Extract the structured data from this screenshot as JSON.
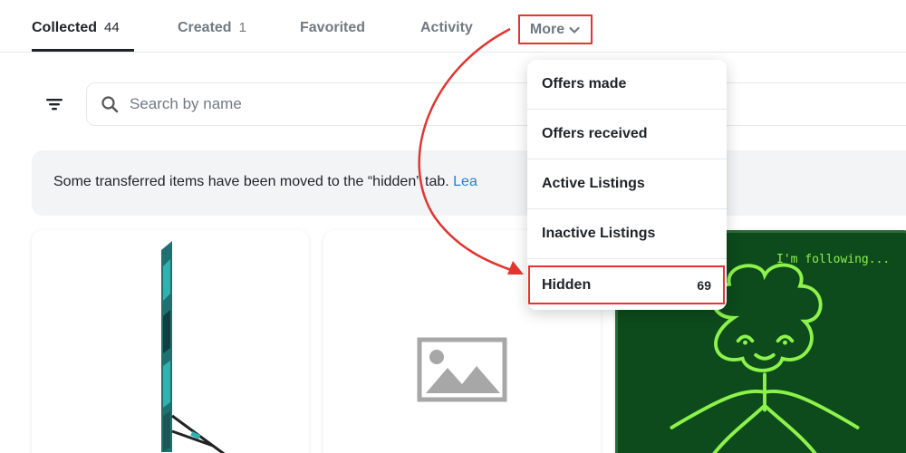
{
  "tabs": [
    {
      "label": "Collected",
      "count": "44"
    },
    {
      "label": "Created",
      "count": "1"
    },
    {
      "label": "Favorited"
    },
    {
      "label": "Activity"
    }
  ],
  "more": {
    "label": "More"
  },
  "search": {
    "placeholder": "Search by name"
  },
  "notice": {
    "text": "Some transferred items have been moved to the “hidden” tab. ",
    "link": "Lea"
  },
  "dropdown": {
    "items": [
      {
        "label": "Offers made"
      },
      {
        "label": "Offers received"
      },
      {
        "label": "Active Listings"
      },
      {
        "label": "Inactive Listings"
      }
    ],
    "hidden": {
      "label": "Hidden",
      "count": "69"
    }
  },
  "cards": {
    "nft3_caption": "I'm following..."
  },
  "colors": {
    "annotation": "#e3342f",
    "accent_link": "#2081e2",
    "nft_green": "#8df24a",
    "nft_bg": "#0d4a1c"
  },
  "icons": [
    "filter-icon",
    "search-icon",
    "chevron-down-icon",
    "image-placeholder-icon"
  ]
}
